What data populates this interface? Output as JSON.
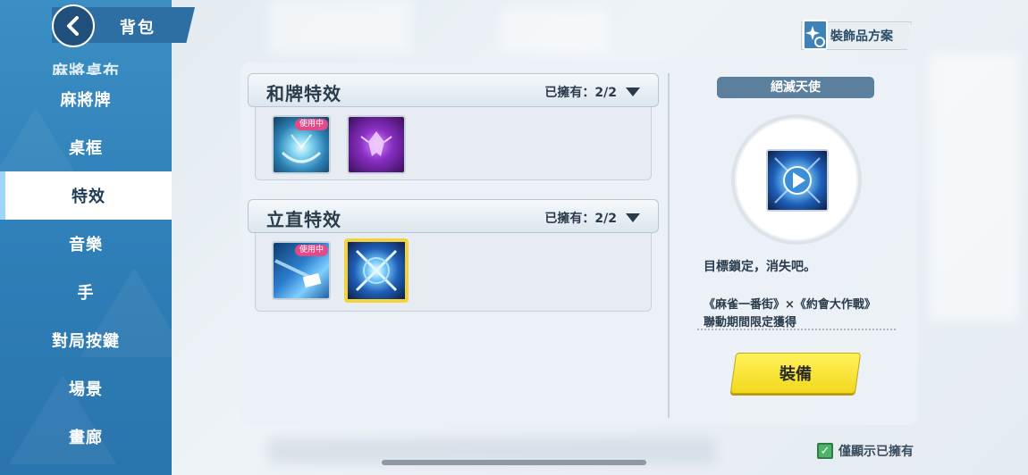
{
  "header": {
    "title": "背包",
    "back_icon": "chevron-left-icon"
  },
  "sidebar": {
    "items": [
      {
        "label": "麻將桌布",
        "state": "partial"
      },
      {
        "label": "麻將牌"
      },
      {
        "label": "桌框"
      },
      {
        "label": "特效",
        "state": "active"
      },
      {
        "label": "音樂"
      },
      {
        "label": "手"
      },
      {
        "label": "對局按鍵"
      },
      {
        "label": "場景"
      },
      {
        "label": "畫廊"
      }
    ]
  },
  "preset": {
    "label": "裝飾品方案",
    "icon": "sparkle-swap-icon"
  },
  "sections": [
    {
      "title": "和牌特效",
      "owned": "已擁有：2/2",
      "items": [
        {
          "icon": "blue-burst-effect",
          "badge": "使用中",
          "selected": false
        },
        {
          "icon": "purple-dragon-effect",
          "badge": "",
          "selected": false
        }
      ]
    },
    {
      "title": "立直特效",
      "owned": "已擁有：2/2",
      "items": [
        {
          "icon": "light-streak-effect",
          "badge": "使用中",
          "selected": false
        },
        {
          "icon": "blue-crossed-swords-effect",
          "badge": "",
          "selected": true
        }
      ]
    }
  ],
  "detail": {
    "name": "絕滅天使",
    "preview_icon": "play-icon",
    "description": "目標鎖定，消失吧。",
    "collab_line1": "《麻雀一番街》×《約會大作戰》",
    "collab_line2": "聯動期間限定獲得",
    "equip_label": "裝備"
  },
  "filter": {
    "label": "僅顯示已擁有",
    "checked": true
  },
  "colors": {
    "accent_yellow": "#f2d81e",
    "sidebar_blue": "#2f7fb8",
    "badge_pink": "#e24b88"
  }
}
